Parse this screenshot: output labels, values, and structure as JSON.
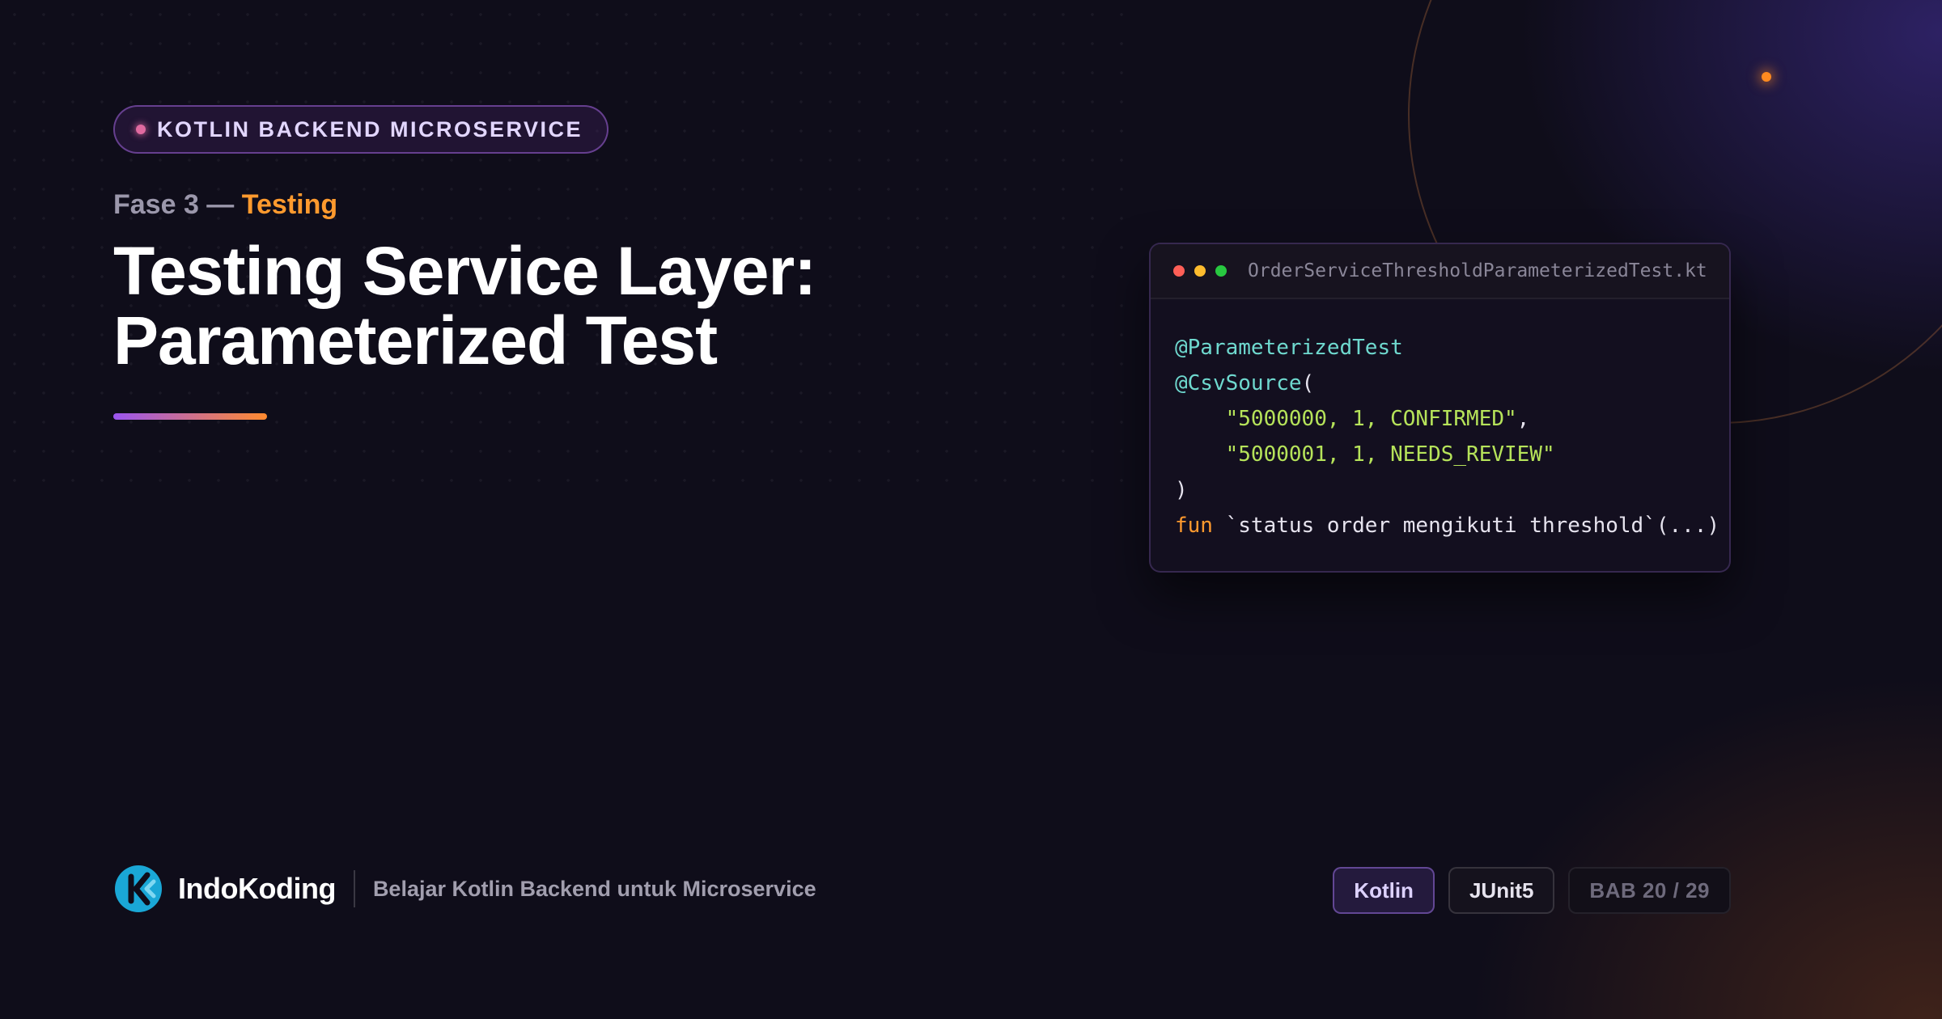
{
  "badge": {
    "label": "KOTLIN BACKEND MICROSERVICE"
  },
  "phase": {
    "prefix": "Fase 3 — ",
    "highlight": "Testing"
  },
  "title": "Testing Service Layer: Parameterized Test",
  "code_window": {
    "filename": "OrderServiceThresholdParameterizedTest.kt",
    "lines": [
      [
        {
          "t": "ann",
          "v": "@ParameterizedTest"
        }
      ],
      [
        {
          "t": "ann",
          "v": "@CsvSource"
        },
        {
          "t": "plain",
          "v": "("
        }
      ],
      [
        {
          "t": "plain",
          "v": "    "
        },
        {
          "t": "str",
          "v": "\"5000000, 1, CONFIRMED\""
        },
        {
          "t": "plain",
          "v": ","
        }
      ],
      [
        {
          "t": "plain",
          "v": "    "
        },
        {
          "t": "str",
          "v": "\"5000001, 1, NEEDS_REVIEW\""
        }
      ],
      [
        {
          "t": "plain",
          "v": ")"
        }
      ],
      [
        {
          "t": "kw",
          "v": "fun"
        },
        {
          "t": "plain",
          "v": " `status order mengikuti threshold`(...)"
        }
      ]
    ]
  },
  "footer": {
    "brand": "IndoKoding",
    "tagline": "Belajar Kotlin Backend untuk Microservice",
    "tags": [
      "Kotlin",
      "JUnit5"
    ],
    "chapter": "BAB 20 / 29"
  },
  "colors": {
    "background": "#0f0d1a",
    "accent_orange": "#ff9a2e",
    "accent_purple": "#9a55f0",
    "annotation": "#6fd9cf",
    "string": "#b6e35a",
    "logo": "#1aa7d6"
  },
  "icons": {
    "logo": "indokoding-logo-icon",
    "window_controls": [
      "close-dot-icon",
      "minimize-dot-icon",
      "maximize-dot-icon"
    ]
  }
}
